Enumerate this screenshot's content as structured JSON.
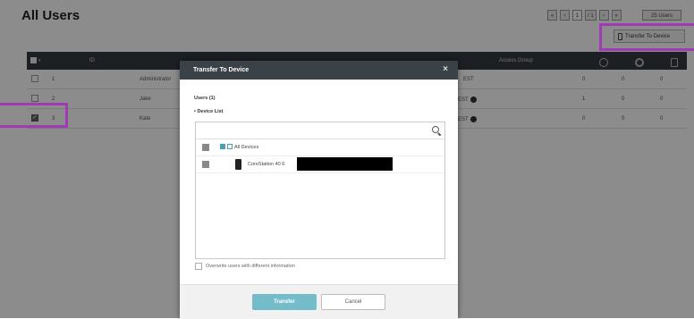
{
  "page": {
    "title": "All Users"
  },
  "pager": {
    "first": "«",
    "prev": "‹",
    "current": "1",
    "total": "/ 1",
    "next": "›",
    "last": "»",
    "per_page": "25 Users"
  },
  "toolbar": {
    "transfer_label": "Transfer To Device"
  },
  "grid": {
    "headers": {
      "select": "▾",
      "no": "ID",
      "access_group": "Access Group"
    },
    "rows": [
      {
        "id": "1",
        "name": "Administrator",
        "group": "EST",
        "face": "0",
        "finger": "0",
        "card": "0",
        "checked": false
      },
      {
        "id": "2",
        "name": "Jake",
        "group": "EST",
        "face": "1",
        "finger": "0",
        "card": "0",
        "checked": false
      },
      {
        "id": "3",
        "name": "Kate",
        "group": "EST",
        "face": "0",
        "finger": "0",
        "card": "0",
        "checked": true
      }
    ]
  },
  "modal": {
    "title": "Transfer To Device",
    "close": "×",
    "users_label": "Users (1)",
    "device_list_label": "• Device List",
    "all_devices": "All Devices",
    "device_name": "CoreStation 40 6",
    "overwrite_label": "Overwrite users with different information",
    "transfer_button": "Transfer",
    "cancel_button": "Cancel"
  },
  "colors": {
    "highlight": "#a13ab5",
    "header_bg": "#333a40",
    "transfer_btn": "#74bcc9"
  },
  "icons": {
    "search": "search-icon",
    "device": "device-icon",
    "close": "close-icon",
    "face": "face-icon",
    "fingerprint": "fingerprint-icon",
    "card": "card-icon"
  }
}
